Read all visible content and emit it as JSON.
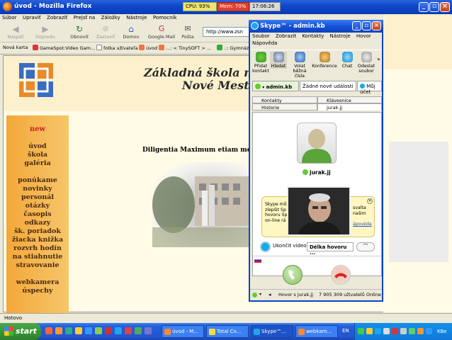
{
  "firefox": {
    "title": "úvod - Mozilla Firefox",
    "tray_cpu": "CPU: 93%",
    "tray_mem": "Mem: 70%",
    "tray_clock": "17:06:26",
    "menu": [
      "Súbor",
      "Upraviť",
      "Zobraziť",
      "Prejsť na",
      "Záložky",
      "Nástroje",
      "Pomocník"
    ],
    "toolbar": {
      "back": "Naspäť",
      "forward": "Dopredu",
      "reload": "Obnoviť",
      "stop": "Zastaviť",
      "home": "Domov",
      "gmail": "Google Mail",
      "mail": "Pošta",
      "address": "http://www.zsn",
      "search_icon": "G"
    },
    "bookmarks": [
      "Nová karta",
      "GameSpot:Video Gam...",
      "fotka užívateľa",
      "úvod",
      "...: < TinySOFT > ...",
      ".:: Gymnáz"
    ],
    "status": "Hotovo"
  },
  "site": {
    "heading_line1": "Základná škola na",
    "heading_line2": "Nové Mesto",
    "motto": "Diligentia Maximum etiam me",
    "nav": [
      "new",
      "úvod",
      "škola",
      "galéria",
      "ponúkame",
      "novinky",
      "personál",
      "otázky",
      "časopis",
      "odkazy",
      "šk. poriadok",
      "žiacka knižka",
      "rozvrh hodín",
      "na stiahnutie",
      "stravovanie",
      "webkamera",
      "úspechy"
    ]
  },
  "skype": {
    "title": "Skype™ - admin.kb",
    "menu": [
      "Soubor",
      "Zobrazit",
      "Kontakty",
      "Nástroje",
      "Hovor",
      "Nápověda"
    ],
    "tools": [
      "Přidat kontakt",
      "Hledat",
      "Volat běžná čísla",
      "Konference",
      "Chat",
      "Odeslat soubor"
    ],
    "status_user": "admin.kb",
    "status_events": "Žádné nové události",
    "status_account": "Můj účet",
    "tabs": [
      "Kontakty",
      "Klávesnice",
      "Historie",
      "jurak.jj"
    ],
    "call_name": "jurak.jj",
    "tip_text": [
      "Skype mů",
      "zlepšit Sp",
      "hovoru Sp",
      "on-line rá"
    ],
    "tip_right": [
      "svalta",
      "našim"
    ],
    "tip_link": "ápověda",
    "end_video": "Ukončit video",
    "call_length": "Délka hovoru ...",
    "footer_call": "Hovor s jurak.jj",
    "footer_online": "7 905 309 uživatelů Online"
  },
  "taskbar": {
    "start": "start",
    "items": [
      "úvod - M...",
      "Total Co...",
      "Skype™...",
      "webkam..."
    ],
    "lang": "EN",
    "clock_label": "KBe"
  }
}
